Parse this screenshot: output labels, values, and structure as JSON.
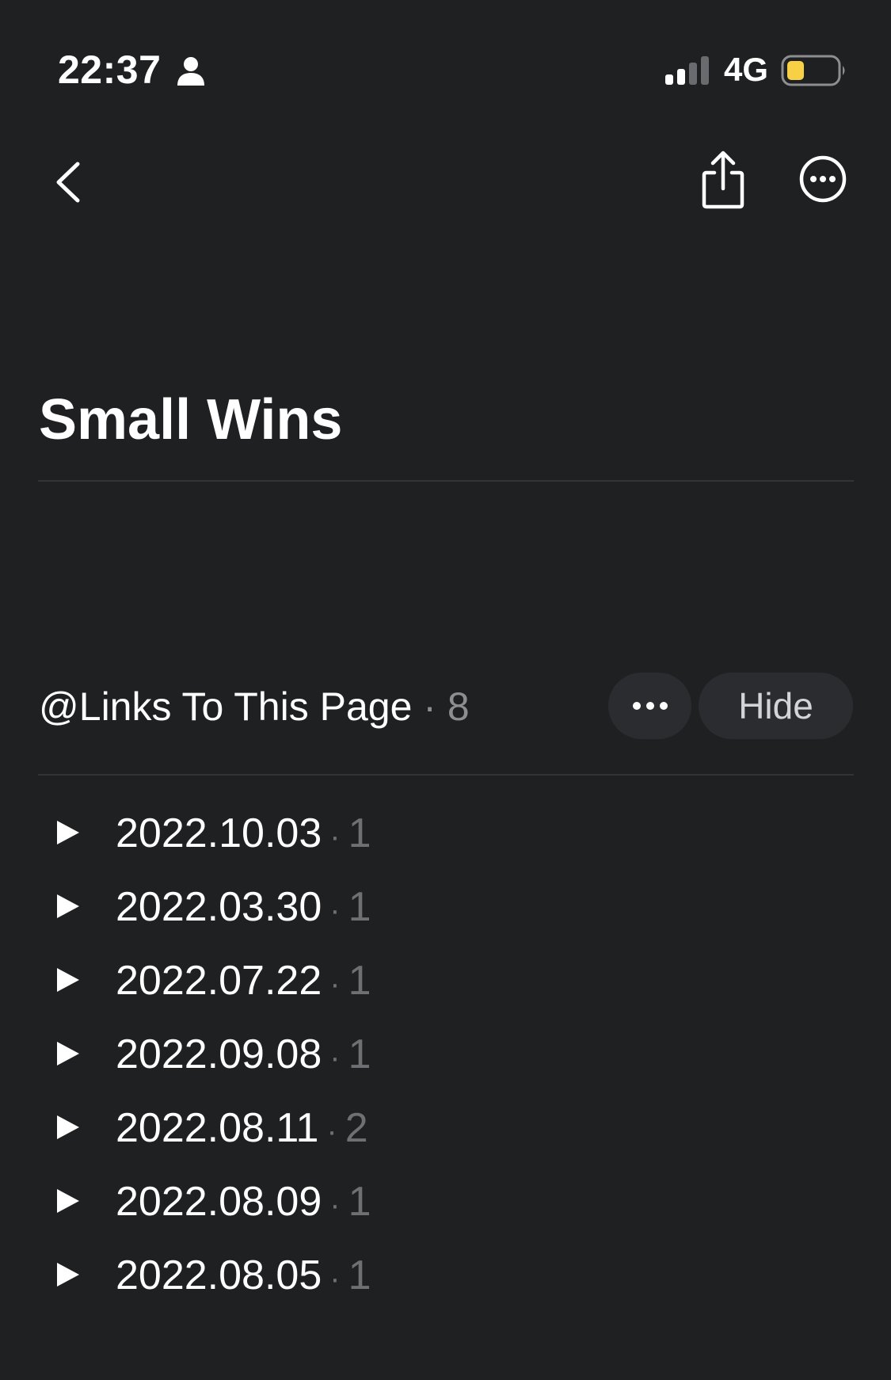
{
  "status_bar": {
    "time": "22:37",
    "network": "4G",
    "battery_color": "#f7d046"
  },
  "nav": {
    "back_icon": "chevron-left-icon",
    "share_icon": "share-icon",
    "more_icon": "ellipsis-circle-icon"
  },
  "page": {
    "title": "Small Wins"
  },
  "links_section": {
    "label": "@Links To This Page",
    "separator": "·",
    "count": "8",
    "more_label": "•••",
    "hide_label": "Hide",
    "items": [
      {
        "date": "2022.10.03",
        "count": "1"
      },
      {
        "date": "2022.03.30",
        "count": "1"
      },
      {
        "date": "2022.07.22",
        "count": "1"
      },
      {
        "date": "2022.09.08",
        "count": "1"
      },
      {
        "date": "2022.08.11",
        "count": "2"
      },
      {
        "date": "2022.08.09",
        "count": "1"
      },
      {
        "date": "2022.08.05",
        "count": "1"
      }
    ]
  },
  "colors": {
    "background": "#1f2022",
    "text": "#ffffff",
    "muted": "#8d8e92",
    "button_bg": "#2b2c2f"
  }
}
